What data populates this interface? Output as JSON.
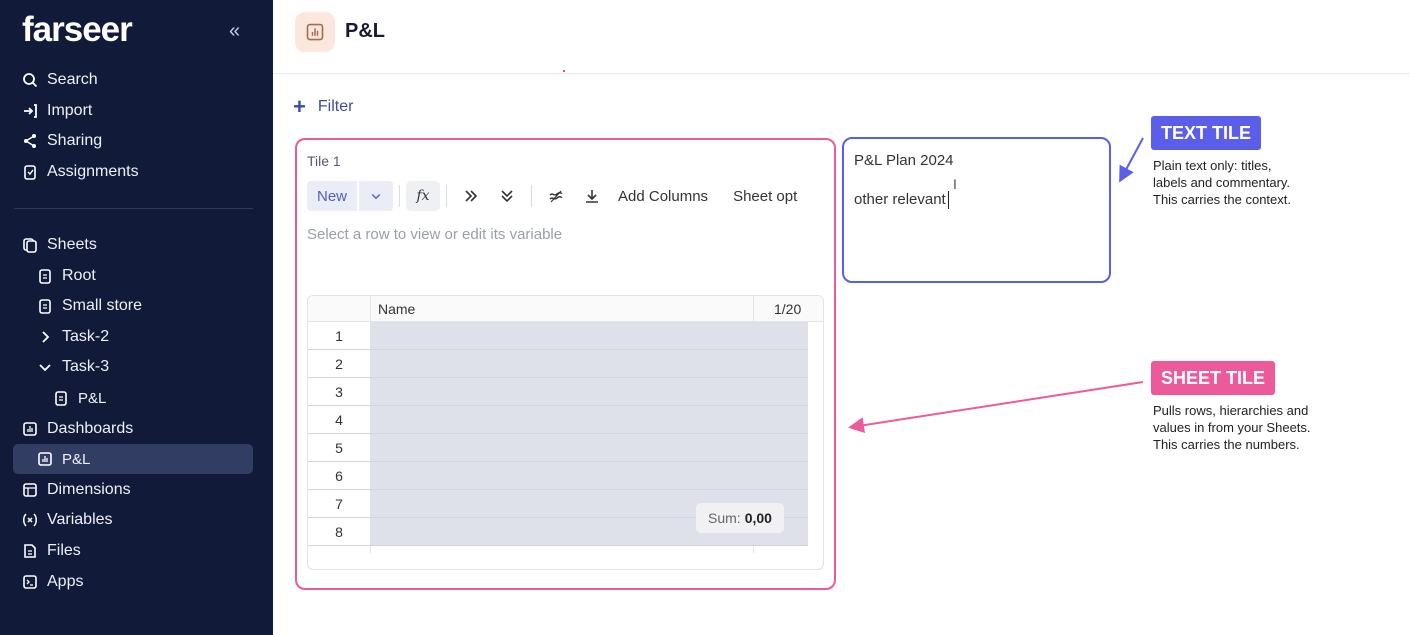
{
  "sidebar": {
    "logo": "farseer",
    "collapse_icon": "«",
    "items": [
      {
        "label": "Search",
        "icon": "search-icon"
      },
      {
        "label": "Import",
        "icon": "import-icon"
      },
      {
        "label": "Sharing",
        "icon": "share-icon"
      },
      {
        "label": "Assignments",
        "icon": "assignments-icon"
      },
      {
        "label": "Sheets",
        "icon": "sheets-icon"
      },
      {
        "label": "Root",
        "icon": "sheet-icon"
      },
      {
        "label": "Small store",
        "icon": "sheet-icon"
      },
      {
        "label": "Task-2",
        "icon": "chevron-right-icon"
      },
      {
        "label": "Task-3",
        "icon": "chevron-down-icon"
      },
      {
        "label": "P&L",
        "icon": "sheet-icon"
      },
      {
        "label": "Dashboards",
        "icon": "dashboard-icon"
      },
      {
        "label": "P&L",
        "icon": "dashboard-icon"
      },
      {
        "label": "Dimensions",
        "icon": "dimensions-icon"
      },
      {
        "label": "Variables",
        "icon": "variables-icon"
      },
      {
        "label": "Files",
        "icon": "files-icon"
      },
      {
        "label": "Apps",
        "icon": "apps-icon"
      }
    ]
  },
  "header": {
    "title": "P&L"
  },
  "filter": {
    "label": "Filter"
  },
  "sheet_tile": {
    "title": "Tile 1",
    "toolbar": {
      "new_label": "New",
      "fx_label": "fx",
      "add_columns_label": "Add Columns",
      "sheet_options_label": "Sheet opt"
    },
    "hint": "Select a row to view or edit its variable",
    "columns": {
      "name": "Name",
      "num": "1/20"
    },
    "rows": [
      "1",
      "2",
      "3",
      "4",
      "5",
      "6",
      "7",
      "8"
    ],
    "sum": {
      "label": "Sum:",
      "value": "0,00"
    }
  },
  "text_tile": {
    "title": "P&L Plan 2024",
    "body": "other relevant"
  },
  "annotations": {
    "text_tile": {
      "badge": "TEXT TILE",
      "line1": "Plain text only: titles,",
      "line2": "labels and commentary.",
      "line3": "This carries the context.",
      "color": "#5b5ee8"
    },
    "sheet_tile": {
      "badge": "SHEET TILE",
      "line1": "Pulls rows, hierarchies and",
      "line2": "values in from your Sheets.",
      "line3": "This carries the numbers.",
      "color": "#ec5a9c"
    }
  }
}
